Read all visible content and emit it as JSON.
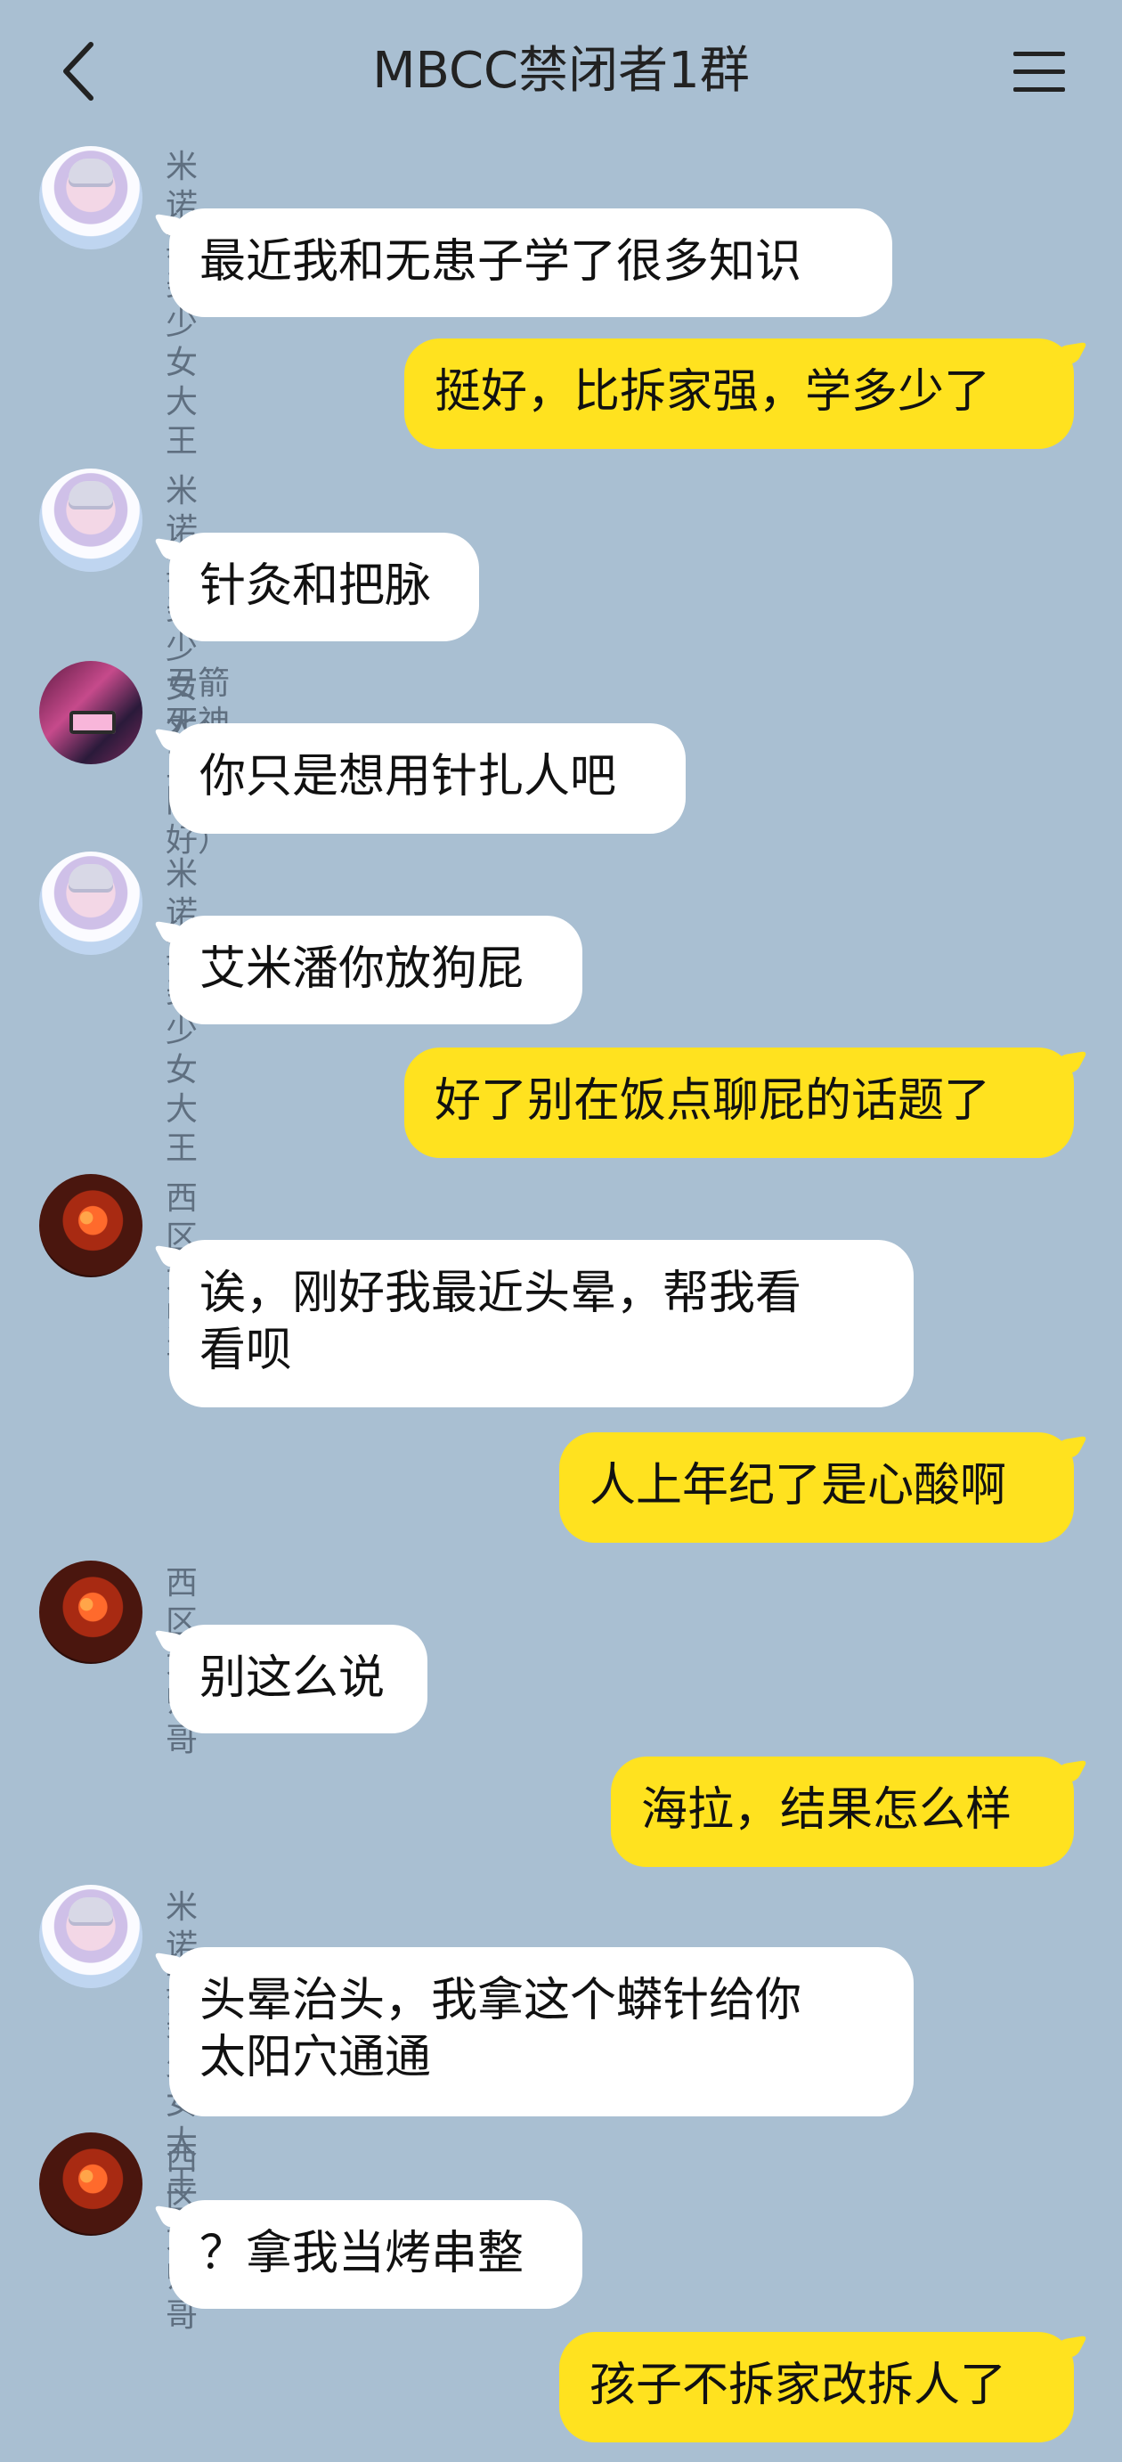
{
  "header": {
    "title": "MBCC禁闭者1群",
    "back_icon": "chevron-left-icon",
    "menu_icon": "hamburger-menu-icon"
  },
  "messages": [
    {
      "sender": "米诺斯美少女大王",
      "text": "最近我和无患子学了很多知识",
      "avatar": "girl-avatar"
    },
    {
      "sender": "",
      "text": "挺好，比拆家强，学多少了",
      "avatar": ""
    },
    {
      "sender": "米诺斯美少女大王",
      "text": "针灸和把脉",
      "avatar": "girl-avatar"
    },
    {
      "sender": "弓箭死神（找同好）",
      "text": "你只是想用针扎人吧",
      "avatar": "pink-avatar"
    },
    {
      "sender": "米诺斯美少女大王",
      "text": "艾米潘你放狗屁",
      "avatar": "girl-avatar"
    },
    {
      "sender": "",
      "text": "好了别在饭点聊屁的话题了",
      "avatar": ""
    },
    {
      "sender": "西区大帅哥",
      "text": "诶，刚好我最近头晕，帮我看\n看呗",
      "avatar": "fire-avatar"
    },
    {
      "sender": "",
      "text": "人上年纪了是心酸啊",
      "avatar": ""
    },
    {
      "sender": "西区大帅哥",
      "text": "别这么说",
      "avatar": "fire-avatar"
    },
    {
      "sender": "",
      "text": "海拉，结果怎么样",
      "avatar": ""
    },
    {
      "sender": "米诺斯美少女大王",
      "text": "头晕治头，我拿这个蟒针给你\n太阳穴通通",
      "avatar": "girl-avatar"
    },
    {
      "sender": "西区大帅哥",
      "text": "？拿我当烤串整",
      "avatar": "fire-avatar"
    },
    {
      "sender": "",
      "text": "孩子不拆家改拆人了",
      "avatar": ""
    }
  ],
  "colors": {
    "background": "#a9bfd2",
    "incoming_bubble": "#ffffff",
    "outgoing_bubble": "#ffe21f"
  }
}
